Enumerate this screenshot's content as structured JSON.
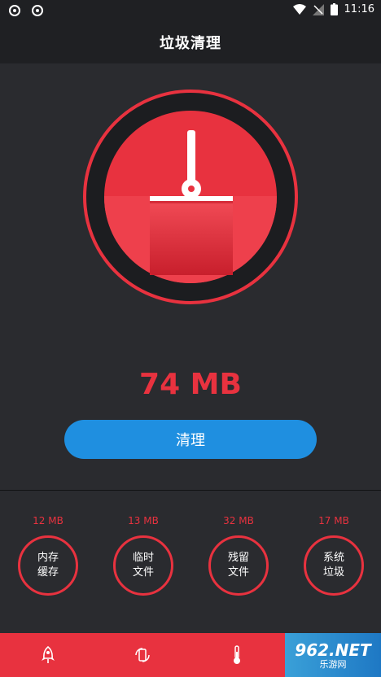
{
  "status_bar": {
    "time": "11:16"
  },
  "header": {
    "title": "垃圾清理"
  },
  "summary": {
    "amount": "74 MB"
  },
  "actions": {
    "clean_label": "清理"
  },
  "categories": [
    {
      "size": "12 MB",
      "line1": "内存",
      "line2": "缓存"
    },
    {
      "size": "13 MB",
      "line1": "临时",
      "line2": "文件"
    },
    {
      "size": "32 MB",
      "line1": "残留",
      "line2": "文件"
    },
    {
      "size": "17 MB",
      "line1": "系统",
      "line2": "垃圾"
    }
  ],
  "bottom_nav": {
    "items": [
      "rocket-icon",
      "phone-refresh-icon",
      "thermometer-icon"
    ]
  },
  "watermark": {
    "main": "962.NET",
    "sub": "乐游网"
  },
  "colors": {
    "accent": "#e8323f",
    "button": "#1f8fe0",
    "background": "#2a2b2f"
  }
}
